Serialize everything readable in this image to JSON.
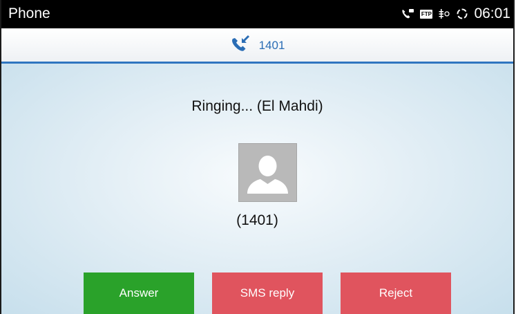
{
  "status_bar": {
    "app_title": "Phone",
    "clock": "06:01",
    "ftp_badge": "FTP"
  },
  "call_header": {
    "number": "1401",
    "icon": "incoming-call-icon"
  },
  "call": {
    "ringing_text": "Ringing... (El Mahdi)",
    "caller_number": "(1401)"
  },
  "actions": {
    "answer_label": "Answer",
    "sms_reply_label": "SMS reply",
    "reject_label": "Reject"
  },
  "colors": {
    "answer": "#2aa22a",
    "reject": "#e0545e",
    "accent": "#2f75c0"
  }
}
